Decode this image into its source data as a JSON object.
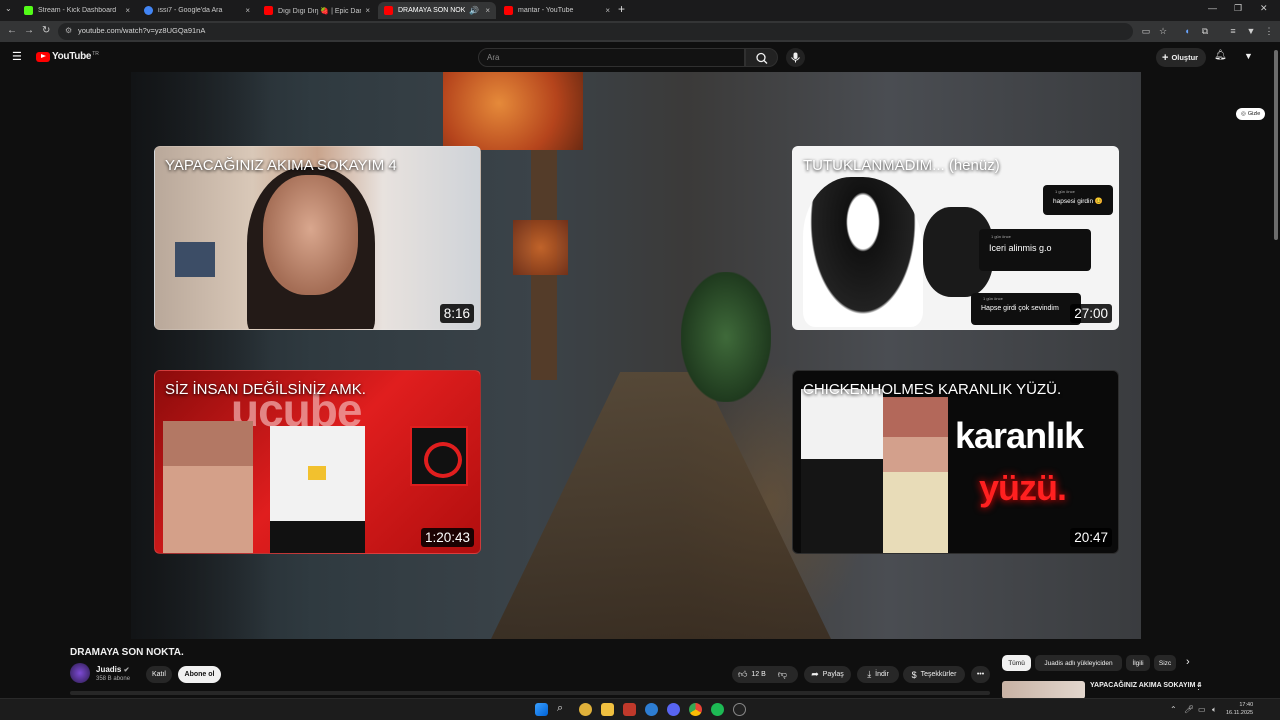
{
  "browser": {
    "tabs": [
      {
        "label": "Stream - Kick Dashboard",
        "color": "#53fc18"
      },
      {
        "label": "issi7 - Google'da Ara",
        "color": "#4285f4"
      },
      {
        "label": "Dıgı Dıgı Dıŋ 🍓 | Epic Dance E",
        "color": "#ff0000"
      },
      {
        "label": "DRAMAYA SON NOKTA. - Y",
        "color": "#ff0000"
      },
      {
        "label": "mantar - YouTube",
        "color": "#ff0000"
      }
    ],
    "new_tab": "+",
    "url": "youtube.com/watch?v=yz8UGQa91nA"
  },
  "masthead": {
    "logo_text": "YouTube",
    "logo_region": "TR",
    "search_placeholder": "Ara",
    "create_label": "Oluştur"
  },
  "player": {
    "hide_label": "Gizle",
    "end_cards": [
      {
        "title": "YAPACAĞINIZ AKIMA SOKAYIM 4",
        "duration": "8:16"
      },
      {
        "title": "TUTUKLANMADIM... (henüz)",
        "duration": "27:00",
        "comments": [
          {
            "meta": "1 gün önce",
            "text": "hapsesi girdin 😊"
          },
          {
            "meta": "1 gün önce",
            "text": "Iceri alinmis g.o"
          },
          {
            "meta": "1 gün önce",
            "text": "Hapse girdi çok sevindim"
          }
        ]
      },
      {
        "title": "SİZ İNSAN DEĞİLSİNİZ AMK.",
        "duration": "1:20:43",
        "thumb_text": "ucube"
      },
      {
        "title": "CHICKENHOLMES KARANLIK YÜZÜ.",
        "duration": "20:47",
        "thumb_text_1": "karanlık",
        "thumb_text_2": "yüzü."
      }
    ]
  },
  "video": {
    "title": "DRAMAYA SON NOKTA.",
    "channel": "Juadis",
    "subscribers": "358 B abone",
    "join_label": "Katıl",
    "subscribe_label": "Abone ol",
    "likes": "12 B",
    "share_label": "Paylaş",
    "download_label": "İndir",
    "thanks_label": "Teşekkürler",
    "more_label": "•••"
  },
  "recommendations": {
    "chips": [
      "Tümü",
      "Juadis adlı yükleyiciden",
      "İlgili",
      "Sizc"
    ],
    "first_title": "YAPACAĞINIZ AKIMA SOKAYIM 4"
  },
  "taskbar": {
    "time": "17:40",
    "date": "16.11.2025"
  },
  "colors": {
    "background": "#0f0f0f",
    "brand_red": "#ff0000",
    "chip_selected": "#f1f1f1"
  }
}
